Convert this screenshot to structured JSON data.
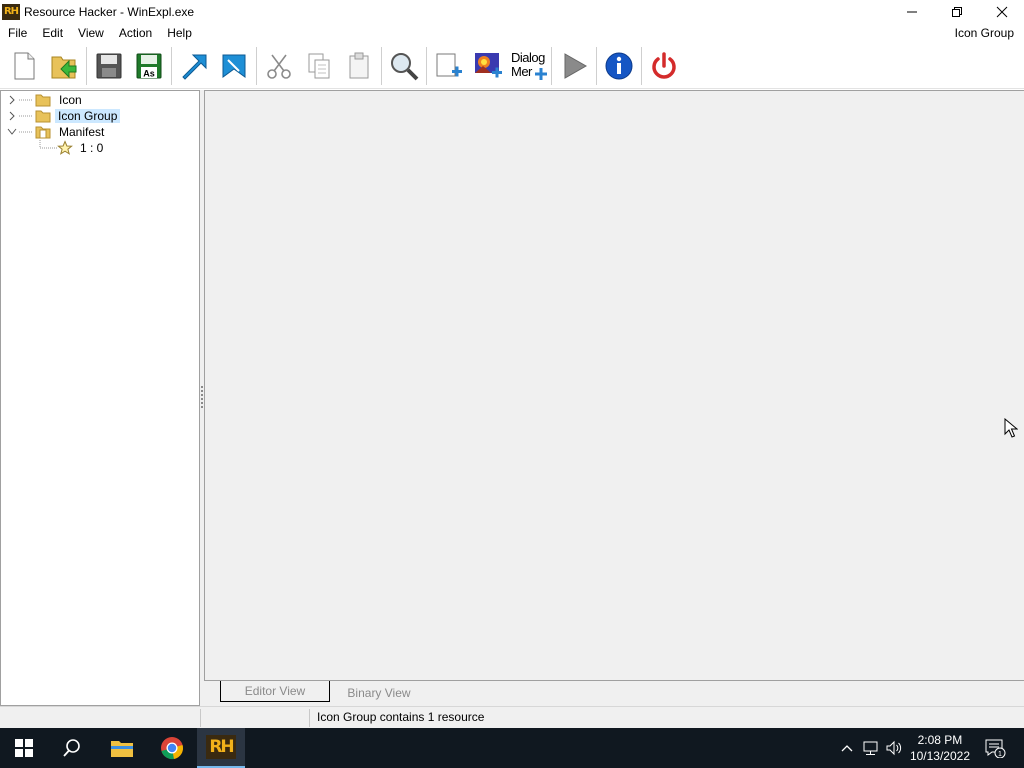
{
  "window": {
    "title": "Resource Hacker - WinExpl.exe",
    "logo_text": "RH"
  },
  "menu": {
    "items": [
      "File",
      "Edit",
      "View",
      "Action",
      "Help"
    ],
    "context_label": "Icon Group"
  },
  "toolbar": {
    "dialog_merge_line1": "Dialog",
    "dialog_merge_line2": "Mer",
    "saveas_label": "As"
  },
  "tree": {
    "items": [
      {
        "label": "Icon",
        "expanded": false,
        "selected": false
      },
      {
        "label": "Icon Group",
        "expanded": false,
        "selected": true
      },
      {
        "label": "Manifest",
        "expanded": true,
        "selected": false
      },
      {
        "label": "1 : 0",
        "expanded": false,
        "selected": false
      }
    ]
  },
  "tabs": {
    "editor_view": "Editor View",
    "binary_view": "Binary View"
  },
  "status": {
    "text": "Icon Group contains 1 resource"
  },
  "taskbar": {
    "time": "2:08 PM",
    "date": "10/13/2022",
    "app_logo": "RH",
    "notification_count": "1"
  },
  "colors": {
    "selection": "#cce8ff",
    "taskbar": "#101820",
    "folder": "#e8c25a",
    "arrow_blue": "#1e8fd6",
    "power_red": "#d42b2b",
    "info_blue": "#1656c4"
  }
}
